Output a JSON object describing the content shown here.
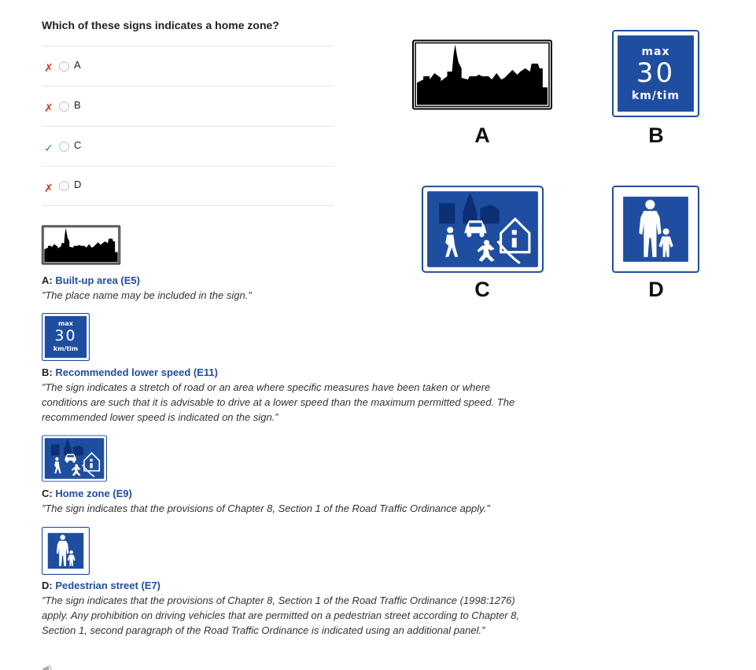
{
  "question": "Which of these signs indicates a home zone?",
  "options": [
    {
      "mark": "✗",
      "status": "wrong",
      "label": "A"
    },
    {
      "mark": "✗",
      "status": "wrong",
      "label": "B"
    },
    {
      "mark": "✓",
      "status": "correct",
      "label": "C"
    },
    {
      "mark": "✗",
      "status": "wrong",
      "label": "D"
    }
  ],
  "sign_text": {
    "max": "max",
    "speed": "30",
    "unit": "km/tim"
  },
  "explanations": [
    {
      "prefix": "A:",
      "name": "Built-up area (E5)",
      "text": "”The place name may be included in the sign.”"
    },
    {
      "prefix": "B:",
      "name": "Recommended lower speed (E11)",
      "text": "”The sign indicates a stretch of road or an area where specific measures have been taken or where conditions are such that it is advisable to drive at a lower speed than the maximum permitted speed. The recommended lower speed is indicated on the sign.”"
    },
    {
      "prefix": "C:",
      "name": "Home zone (E9)",
      "text": "”The sign indicates that the provisions of Chapter 8, Section 1 of the Road Traffic Ordinance apply.”"
    },
    {
      "prefix": "D:",
      "name": "Pedestrian street (E7)",
      "text": "”The sign indicates that the provisions of Chapter 8, Section 1 of the Road Traffic Ordinance (1998:1276) apply. Any prohibition on driving vehicles that are permitted on a pedestrian street according to Chapter 8, Section 1, second paragraph of the Road Traffic Ordinance is indicated using an additional panel.”"
    }
  ],
  "grid_letters": [
    "A",
    "B",
    "C",
    "D"
  ],
  "colors": {
    "sign_blue": "#1f4ea0",
    "link": "#1f4ea0",
    "wrong": "#d9302c",
    "correct": "#2e9a2e"
  }
}
